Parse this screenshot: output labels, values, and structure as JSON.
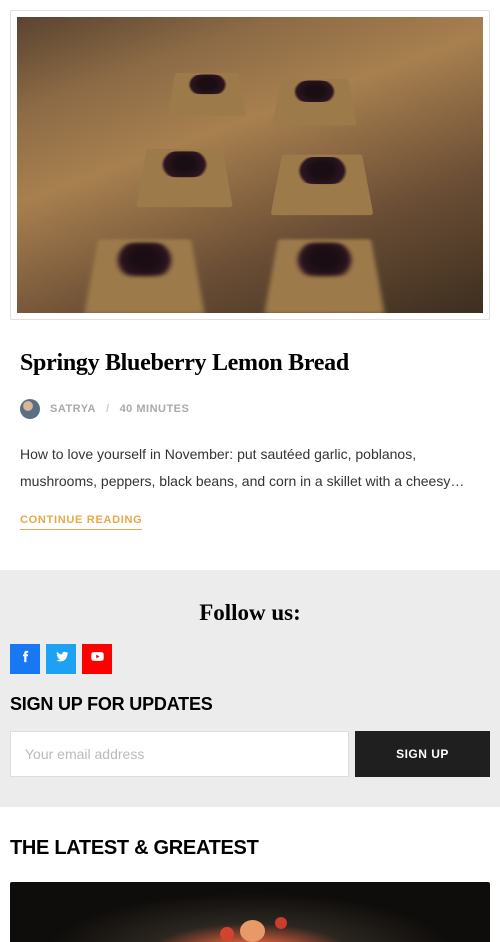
{
  "article": {
    "title": "Springy Blueberry Lemon Bread",
    "author": "SATRYA",
    "duration": "40 MINUTES",
    "excerpt": "How to love yourself in November: put sautéed garlic, poblanos, mushrooms, peppers, black beans, and corn in a skillet with a cheesy…",
    "continue_label": "CONTINUE READING"
  },
  "follow": {
    "title": "Follow us:",
    "social": [
      {
        "name": "facebook"
      },
      {
        "name": "twitter"
      },
      {
        "name": "youtube"
      }
    ]
  },
  "signup": {
    "heading": "SIGN UP FOR UPDATES",
    "placeholder": "Your email address",
    "button": "SIGN UP"
  },
  "latest": {
    "heading": "THE LATEST & GREATEST"
  }
}
